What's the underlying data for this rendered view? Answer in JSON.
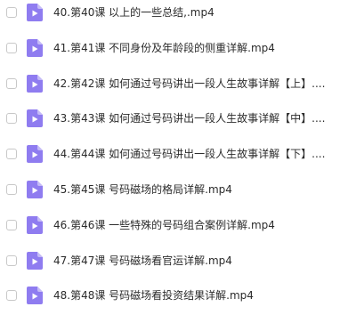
{
  "files": [
    {
      "name": "40.第40课  以上的一些总结,.mp4",
      "icon": "video-file-icon"
    },
    {
      "name": "41.第41课  不同身份及年龄段的侧重详解.mp4",
      "icon": "video-file-icon"
    },
    {
      "name": "42.第42课  如何通过号码讲出一段人生故事详解【上】....",
      "icon": "video-file-icon"
    },
    {
      "name": "43.第43课  如何通过号码讲出一段人生故事详解【中】....",
      "icon": "video-file-icon"
    },
    {
      "name": "44.第44课  如何通过号码讲出一段人生故事详解【下】....",
      "icon": "video-file-icon"
    },
    {
      "name": "45.第45课  号码磁场的格局详解.mp4",
      "icon": "video-file-icon"
    },
    {
      "name": "46.第46课  一些特殊的号码组合案例详解.mp4",
      "icon": "video-file-icon"
    },
    {
      "name": "47.第47课  号码磁场看官运详解.mp4",
      "icon": "video-file-icon"
    },
    {
      "name": "48.第48课  号码磁场看投资结果详解.mp4",
      "icon": "video-file-icon"
    }
  ],
  "colors": {
    "icon_fill": "#8f7cf0",
    "icon_fold": "#c5bbf7",
    "icon_play": "#ffffff",
    "checkbox_border": "#c8c8c8",
    "text": "#2b2b2b"
  }
}
